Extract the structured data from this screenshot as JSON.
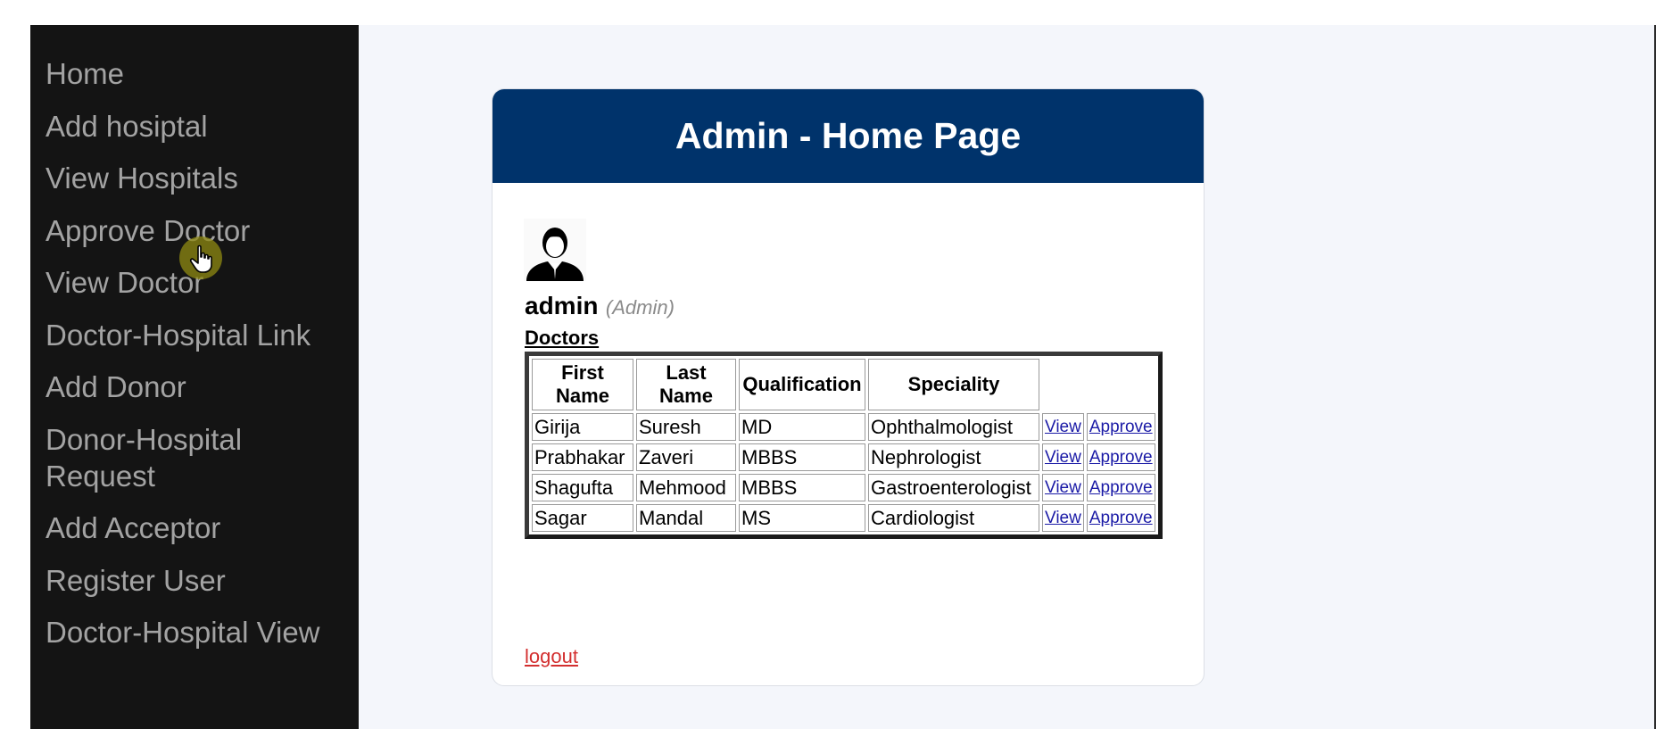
{
  "sidebar": {
    "items": [
      {
        "label": "Home"
      },
      {
        "label": "Add hosiptal"
      },
      {
        "label": "View Hospitals"
      },
      {
        "label": "Approve Doctor"
      },
      {
        "label": "View Doctor"
      },
      {
        "label": "Doctor-Hospital Link"
      },
      {
        "label": "Add Donor"
      },
      {
        "label": "Donor-Hospital Request"
      },
      {
        "label": "Add Acceptor"
      },
      {
        "label": "Register User"
      },
      {
        "label": "Doctor-Hospital View"
      }
    ]
  },
  "header": {
    "title": "Admin - Home Page"
  },
  "user": {
    "name": "admin",
    "role": "(Admin)",
    "avatar_icon": "user-avatar-icon"
  },
  "doctors": {
    "title": "Doctors",
    "columns": [
      "First Name",
      "Last Name",
      "Qualification",
      "Speciality",
      ""
    ],
    "rows": [
      {
        "first": "Girija",
        "last": "Suresh",
        "qualification": "MD",
        "speciality": "Ophthalmologist",
        "view": "View",
        "approve": "Approve"
      },
      {
        "first": "Prabhakar",
        "last": "Zaveri",
        "qualification": "MBBS",
        "speciality": "Nephrologist",
        "view": "View",
        "approve": "Approve"
      },
      {
        "first": "Shagufta",
        "last": "Mehmood",
        "qualification": "MBBS",
        "speciality": "Gastroenterologist",
        "view": "View",
        "approve": "Approve"
      },
      {
        "first": "Sagar",
        "last": "Mandal",
        "qualification": "MS",
        "speciality": "Cardiologist",
        "view": "View",
        "approve": "Approve"
      }
    ]
  },
  "logout": {
    "label": "logout"
  },
  "colors": {
    "sidebar_bg": "#141414",
    "sidebar_text": "#a3a3a3",
    "header_bg": "#00336b",
    "link": "#1a1aa6",
    "logout": "#d32f2f",
    "content_bg": "#f4f6fb"
  }
}
